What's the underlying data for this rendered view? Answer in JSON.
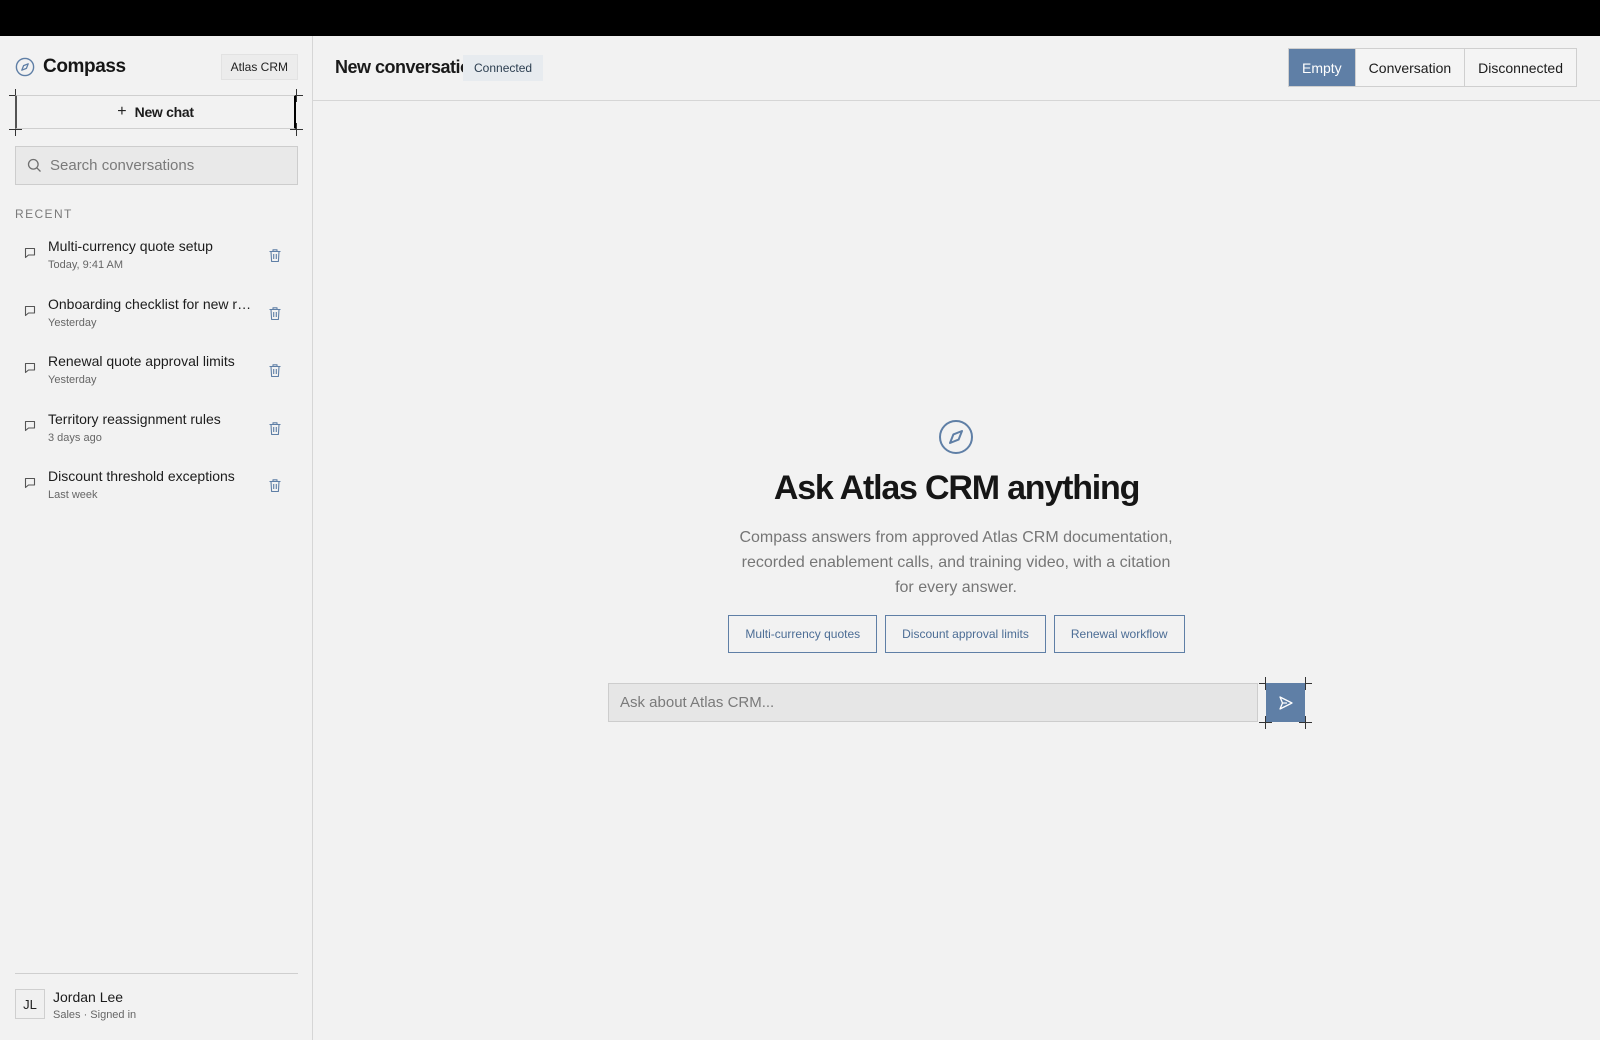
{
  "sidebar": {
    "brand_name": "Compass",
    "org_badge": "Atlas CRM",
    "new_chat_label": "New chat",
    "search_placeholder": "Search conversations",
    "section_label": "RECENT",
    "conversations": [
      {
        "title": "Multi-currency quote setup",
        "time": "Today, 9:41 AM"
      },
      {
        "title": "Onboarding checklist for new reps",
        "time": "Yesterday"
      },
      {
        "title": "Renewal quote approval limits",
        "time": "Yesterday"
      },
      {
        "title": "Territory reassignment rules",
        "time": "3 days ago"
      },
      {
        "title": "Discount threshold exceptions",
        "time": "Last week"
      }
    ],
    "user": {
      "initials": "JL",
      "name": "Jordan Lee",
      "role": "Sales · Signed in"
    }
  },
  "header": {
    "title": "New conversation",
    "status": "Connected",
    "states": [
      "Empty",
      "Conversation",
      "Disconnected"
    ],
    "active_state": "Empty"
  },
  "empty_state": {
    "icon": "compass-icon",
    "title": "Ask Atlas CRM anything",
    "subtitle": "Compass answers from approved Atlas CRM documentation, recorded enablement calls, and training video, with a citation for every answer.",
    "suggestions": [
      "Multi-currency quotes",
      "Discount approval limits",
      "Renewal workflow"
    ]
  },
  "composer": {
    "placeholder": "Ask about Atlas CRM..."
  },
  "colors": {
    "accent": "#5f7fa6",
    "background": "#f2f2f2",
    "top_bar": "#000000"
  }
}
